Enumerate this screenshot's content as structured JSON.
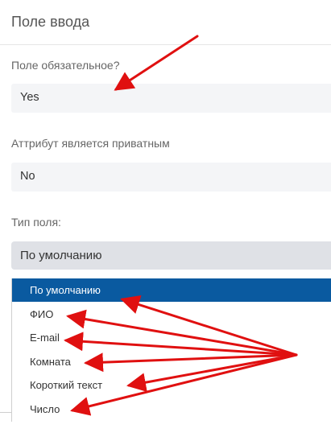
{
  "header": {
    "title": "Поле ввода"
  },
  "required": {
    "label": "Поле обязательное?",
    "value": "Yes"
  },
  "private": {
    "label": "Аттрибут является приватным",
    "value": "No"
  },
  "field_type": {
    "label": "Тип поля:",
    "selected": "По умолчанию",
    "options": [
      "По умолчанию",
      "ФИО",
      "E-mail",
      "Комната",
      "Короткий текст",
      "Число"
    ]
  },
  "colors": {
    "annotation_arrow": "#e01010",
    "selected_option": "#0a5aa0"
  }
}
